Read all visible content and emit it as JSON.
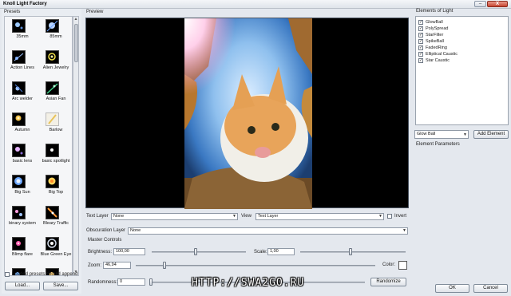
{
  "window": {
    "title": "Knoll Light Factory",
    "min_label": "–",
    "close_label": "X"
  },
  "presets": {
    "label": "Presets",
    "items": [
      "35mm",
      "85mm",
      "Action Lines",
      "Alien Jewelry",
      "Arc welder",
      "Asian Fan",
      "Autumn",
      "Barlow",
      "basic lens",
      "basic spotlight",
      "Big Sun",
      "Big Top",
      "binary system",
      "Bleary Traffic",
      "Blimp flare",
      "Blue Green Eye"
    ],
    "append_label": "Loaded presets should append",
    "load_label": "Load...",
    "save_label": "Save..."
  },
  "preview": {
    "label": "Preview"
  },
  "controls": {
    "text_layer_label": "Text Layer",
    "text_layer_value": "None",
    "view_label": "View",
    "view_value": "Text Layer",
    "invert_label": "Invert",
    "obscuration_label": "Obscuration Layer",
    "obscuration_value": "None",
    "master_label": "Master Controls",
    "brightness_label": "Brightness:",
    "brightness_value": "100,00",
    "scale_label": "Scale:",
    "scale_value": "1,00",
    "zoom_label": "Zoom:",
    "zoom_value": "46,94",
    "color_label": "Color:",
    "randomness_label": "Randomness:",
    "randomness_value": "0",
    "randomize_label": "Randomize"
  },
  "elements": {
    "label": "Elements of Light",
    "items": [
      "GlowBall",
      "PolySpread",
      "StarFilter",
      "SpikeBall",
      "FadedRing",
      "Elliptical Caustic",
      "Star Caustic"
    ],
    "add_select_value": "Glow Ball",
    "add_button_label": "Add Element",
    "params_label": "Element Parameters"
  },
  "footer": {
    "ok_label": "OK",
    "cancel_label": "Cancel"
  },
  "watermark": "HTTP://SWA2GO.RU"
}
